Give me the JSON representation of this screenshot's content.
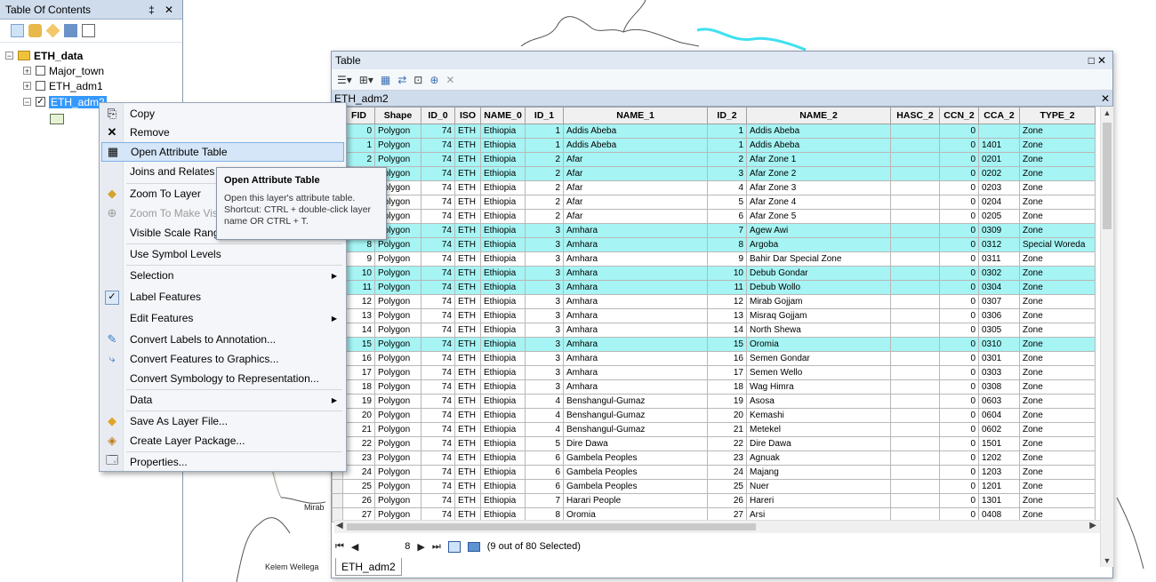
{
  "toc": {
    "title": "Table Of Contents",
    "title_buttons": "‡ ✕",
    "root": "ETH_data",
    "layers": [
      {
        "label": "Major_town",
        "checked": false
      },
      {
        "label": "ETH_adm1",
        "checked": false
      },
      {
        "label": "ETH_adm2",
        "checked": true
      }
    ]
  },
  "map": {
    "labels": [
      "Mirab",
      "Kelem Wellega"
    ]
  },
  "context_menu": {
    "items": [
      {
        "label": "Copy",
        "icon": "copy-icon"
      },
      {
        "label": "Remove",
        "icon": "remove-icon"
      },
      {
        "label": "Open Attribute Table",
        "icon": "table-icon"
      },
      {
        "label": "Joins and Relates",
        "icon": ""
      },
      {
        "label": "Zoom To Layer",
        "icon": "zoom-layer-icon"
      },
      {
        "label": "Zoom To Make Visible",
        "icon": "zoom-visible-icon"
      },
      {
        "label": "Visible Scale Range",
        "icon": ""
      },
      {
        "label": "Use Symbol Levels",
        "icon": ""
      },
      {
        "label": "Selection",
        "icon": ""
      },
      {
        "label": "Label Features",
        "icon": "checkbox-icon"
      },
      {
        "label": "Edit Features",
        "icon": ""
      },
      {
        "label": "Convert Labels to Annotation...",
        "icon": "annotation-icon"
      },
      {
        "label": "Convert Features to Graphics...",
        "icon": "graphics-icon"
      },
      {
        "label": "Convert Symbology to Representation...",
        "icon": ""
      },
      {
        "label": "Data",
        "icon": ""
      },
      {
        "label": "Save As Layer File...",
        "icon": "layer-file-icon"
      },
      {
        "label": "Create Layer Package...",
        "icon": "layer-package-icon"
      },
      {
        "label": "Properties...",
        "icon": "properties-icon"
      }
    ]
  },
  "tooltip": {
    "title": "Open Attribute Table",
    "body": "Open this layer's attribute table. Shortcut: CTRL + double-click layer name OR CTRL + T."
  },
  "table_window": {
    "title": "Table",
    "tab_name": "ETH_adm2",
    "columns": [
      "FID",
      "Shape",
      "ID_0",
      "ISO",
      "NAME_0",
      "ID_1",
      "NAME_1",
      "ID_2",
      "NAME_2",
      "HASC_2",
      "CCN_2",
      "CCA_2",
      "TYPE_2"
    ],
    "rows": [
      {
        "selected": true,
        "cells": [
          "0",
          "Polygon",
          "74",
          "ETH",
          "Ethiopia",
          "1",
          "Addis Abeba",
          "1",
          "Addis Abeba",
          "",
          "0",
          "",
          "Zone"
        ]
      },
      {
        "selected": true,
        "cells": [
          "1",
          "Polygon",
          "74",
          "ETH",
          "Ethiopia",
          "1",
          "Addis Abeba",
          "1",
          "Addis Abeba",
          "",
          "0",
          "1401",
          "Zone"
        ]
      },
      {
        "selected": true,
        "cells": [
          "2",
          "Polygon",
          "74",
          "ETH",
          "Ethiopia",
          "2",
          "Afar",
          "2",
          "Afar Zone 1",
          "",
          "0",
          "0201",
          "Zone"
        ]
      },
      {
        "selected": true,
        "cells": [
          "3",
          "Polygon",
          "74",
          "ETH",
          "Ethiopia",
          "2",
          "Afar",
          "3",
          "Afar Zone 2",
          "",
          "0",
          "0202",
          "Zone"
        ]
      },
      {
        "selected": false,
        "cells": [
          "4",
          "Polygon",
          "74",
          "ETH",
          "Ethiopia",
          "2",
          "Afar",
          "4",
          "Afar Zone 3",
          "",
          "0",
          "0203",
          "Zone"
        ]
      },
      {
        "selected": false,
        "cells": [
          "5",
          "Polygon",
          "74",
          "ETH",
          "Ethiopia",
          "2",
          "Afar",
          "5",
          "Afar Zone 4",
          "",
          "0",
          "0204",
          "Zone"
        ]
      },
      {
        "selected": false,
        "cells": [
          "6",
          "Polygon",
          "74",
          "ETH",
          "Ethiopia",
          "2",
          "Afar",
          "6",
          "Afar Zone 5",
          "",
          "0",
          "0205",
          "Zone"
        ]
      },
      {
        "selected": true,
        "cells": [
          "7",
          "Polygon",
          "74",
          "ETH",
          "Ethiopia",
          "3",
          "Amhara",
          "7",
          "Agew Awi",
          "",
          "0",
          "0309",
          "Zone"
        ]
      },
      {
        "selected": true,
        "cells": [
          "8",
          "Polygon",
          "74",
          "ETH",
          "Ethiopia",
          "3",
          "Amhara",
          "8",
          "Argoba",
          "",
          "0",
          "0312",
          "Special Woreda"
        ]
      },
      {
        "selected": false,
        "cells": [
          "9",
          "Polygon",
          "74",
          "ETH",
          "Ethiopia",
          "3",
          "Amhara",
          "9",
          "Bahir Dar Special Zone",
          "",
          "0",
          "0311",
          "Zone"
        ]
      },
      {
        "selected": true,
        "cells": [
          "10",
          "Polygon",
          "74",
          "ETH",
          "Ethiopia",
          "3",
          "Amhara",
          "10",
          "Debub Gondar",
          "",
          "0",
          "0302",
          "Zone"
        ]
      },
      {
        "selected": true,
        "cells": [
          "11",
          "Polygon",
          "74",
          "ETH",
          "Ethiopia",
          "3",
          "Amhara",
          "11",
          "Debub Wollo",
          "",
          "0",
          "0304",
          "Zone"
        ]
      },
      {
        "selected": false,
        "cells": [
          "12",
          "Polygon",
          "74",
          "ETH",
          "Ethiopia",
          "3",
          "Amhara",
          "12",
          "Mirab Gojjam",
          "",
          "0",
          "0307",
          "Zone"
        ]
      },
      {
        "selected": false,
        "cells": [
          "13",
          "Polygon",
          "74",
          "ETH",
          "Ethiopia",
          "3",
          "Amhara",
          "13",
          "Misraq Gojjam",
          "",
          "0",
          "0306",
          "Zone"
        ]
      },
      {
        "selected": false,
        "cells": [
          "14",
          "Polygon",
          "74",
          "ETH",
          "Ethiopia",
          "3",
          "Amhara",
          "14",
          "North Shewa",
          "",
          "0",
          "0305",
          "Zone"
        ]
      },
      {
        "selected": true,
        "cells": [
          "15",
          "Polygon",
          "74",
          "ETH",
          "Ethiopia",
          "3",
          "Amhara",
          "15",
          "Oromia",
          "",
          "0",
          "0310",
          "Zone"
        ]
      },
      {
        "selected": false,
        "cells": [
          "16",
          "Polygon",
          "74",
          "ETH",
          "Ethiopia",
          "3",
          "Amhara",
          "16",
          "Semen Gondar",
          "",
          "0",
          "0301",
          "Zone"
        ]
      },
      {
        "selected": false,
        "cells": [
          "17",
          "Polygon",
          "74",
          "ETH",
          "Ethiopia",
          "3",
          "Amhara",
          "17",
          "Semen Wello",
          "",
          "0",
          "0303",
          "Zone"
        ]
      },
      {
        "selected": false,
        "cells": [
          "18",
          "Polygon",
          "74",
          "ETH",
          "Ethiopia",
          "3",
          "Amhara",
          "18",
          "Wag Himra",
          "",
          "0",
          "0308",
          "Zone"
        ]
      },
      {
        "selected": false,
        "cells": [
          "19",
          "Polygon",
          "74",
          "ETH",
          "Ethiopia",
          "4",
          "Benshangul-Gumaz",
          "19",
          "Asosa",
          "",
          "0",
          "0603",
          "Zone"
        ]
      },
      {
        "selected": false,
        "cells": [
          "20",
          "Polygon",
          "74",
          "ETH",
          "Ethiopia",
          "4",
          "Benshangul-Gumaz",
          "20",
          "Kemashi",
          "",
          "0",
          "0604",
          "Zone"
        ]
      },
      {
        "selected": false,
        "cells": [
          "21",
          "Polygon",
          "74",
          "ETH",
          "Ethiopia",
          "4",
          "Benshangul-Gumaz",
          "21",
          "Metekel",
          "",
          "0",
          "0602",
          "Zone"
        ]
      },
      {
        "selected": false,
        "cells": [
          "22",
          "Polygon",
          "74",
          "ETH",
          "Ethiopia",
          "5",
          "Dire Dawa",
          "22",
          "Dire Dawa",
          "",
          "0",
          "1501",
          "Zone"
        ]
      },
      {
        "selected": false,
        "cells": [
          "23",
          "Polygon",
          "74",
          "ETH",
          "Ethiopia",
          "6",
          "Gambela Peoples",
          "23",
          "Agnuak",
          "",
          "0",
          "1202",
          "Zone"
        ]
      },
      {
        "selected": false,
        "cells": [
          "24",
          "Polygon",
          "74",
          "ETH",
          "Ethiopia",
          "6",
          "Gambela Peoples",
          "24",
          "Majang",
          "",
          "0",
          "1203",
          "Zone"
        ]
      },
      {
        "selected": false,
        "cells": [
          "25",
          "Polygon",
          "74",
          "ETH",
          "Ethiopia",
          "6",
          "Gambela Peoples",
          "25",
          "Nuer",
          "",
          "0",
          "1201",
          "Zone"
        ]
      },
      {
        "selected": false,
        "cells": [
          "26",
          "Polygon",
          "74",
          "ETH",
          "Ethiopia",
          "7",
          "Harari People",
          "26",
          "Hareri",
          "",
          "0",
          "1301",
          "Zone"
        ]
      },
      {
        "selected": false,
        "cells": [
          "27",
          "Polygon",
          "74",
          "ETH",
          "Ethiopia",
          "8",
          "Oromia",
          "27",
          "Arsi",
          "",
          "0",
          "0408",
          "Zone"
        ]
      }
    ],
    "current_record": "8",
    "selection_status": "(9 out of 80 Selected)"
  }
}
